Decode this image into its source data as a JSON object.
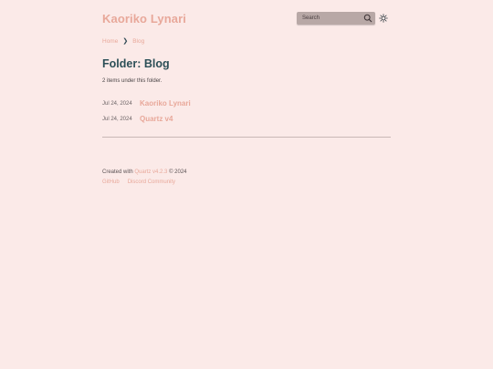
{
  "header": {
    "site_title": "Kaoriko Lynari",
    "search_placeholder": "Search"
  },
  "breadcrumb": {
    "home": "Home",
    "separator": "❯",
    "current": "Blog"
  },
  "folder": {
    "title": "Folder: Blog",
    "description": "2 items under this folder."
  },
  "items": [
    {
      "date": "Jul 24, 2024",
      "title": "Kaoriko Lynari"
    },
    {
      "date": "Jul 24, 2024",
      "title": "Quartz v4"
    }
  ],
  "footer": {
    "created_with": "Created with",
    "quartz_link": "Quartz v4.2.3",
    "copyright": "© 2024",
    "links": [
      "GitHub",
      "Discord Community"
    ]
  },
  "colors": {
    "background": "#fbeae8",
    "accent": "#e8a89a",
    "heading": "#2c4f57"
  }
}
